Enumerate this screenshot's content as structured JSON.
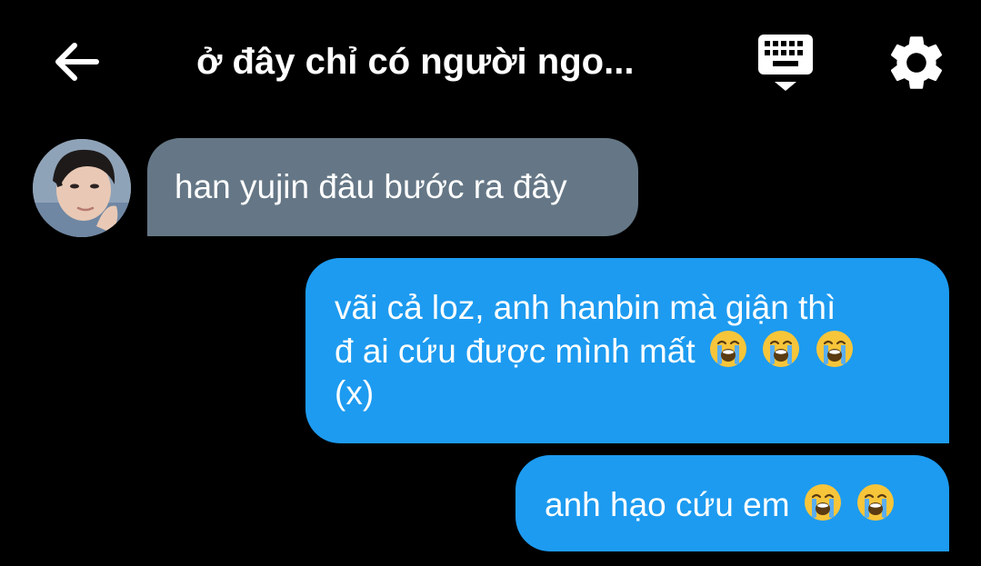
{
  "header": {
    "title": "ở đây chỉ có người ngo...",
    "back_icon": "arrow-left-icon",
    "keyboard_icon": "keyboard-hide-icon",
    "settings_icon": "gear-icon"
  },
  "messages": [
    {
      "direction": "incoming",
      "text": "han yujin đâu bước ra đây",
      "emojis": []
    },
    {
      "direction": "outgoing",
      "text_line1": "vãi cả loz, anh hanbin mà giận thì",
      "text_line2": "đ ai cứu được mình mất",
      "text_line3": "(x)",
      "emojis": [
        "loudly-crying-face",
        "loudly-crying-face",
        "loudly-crying-face"
      ]
    },
    {
      "direction": "outgoing",
      "text": "anh hạo cứu em",
      "emojis": [
        "loudly-crying-face",
        "loudly-crying-face"
      ]
    }
  ],
  "colors": {
    "background": "#000000",
    "incoming_bubble": "#657786",
    "outgoing_bubble": "#1d9bf0",
    "text": "#ffffff"
  }
}
